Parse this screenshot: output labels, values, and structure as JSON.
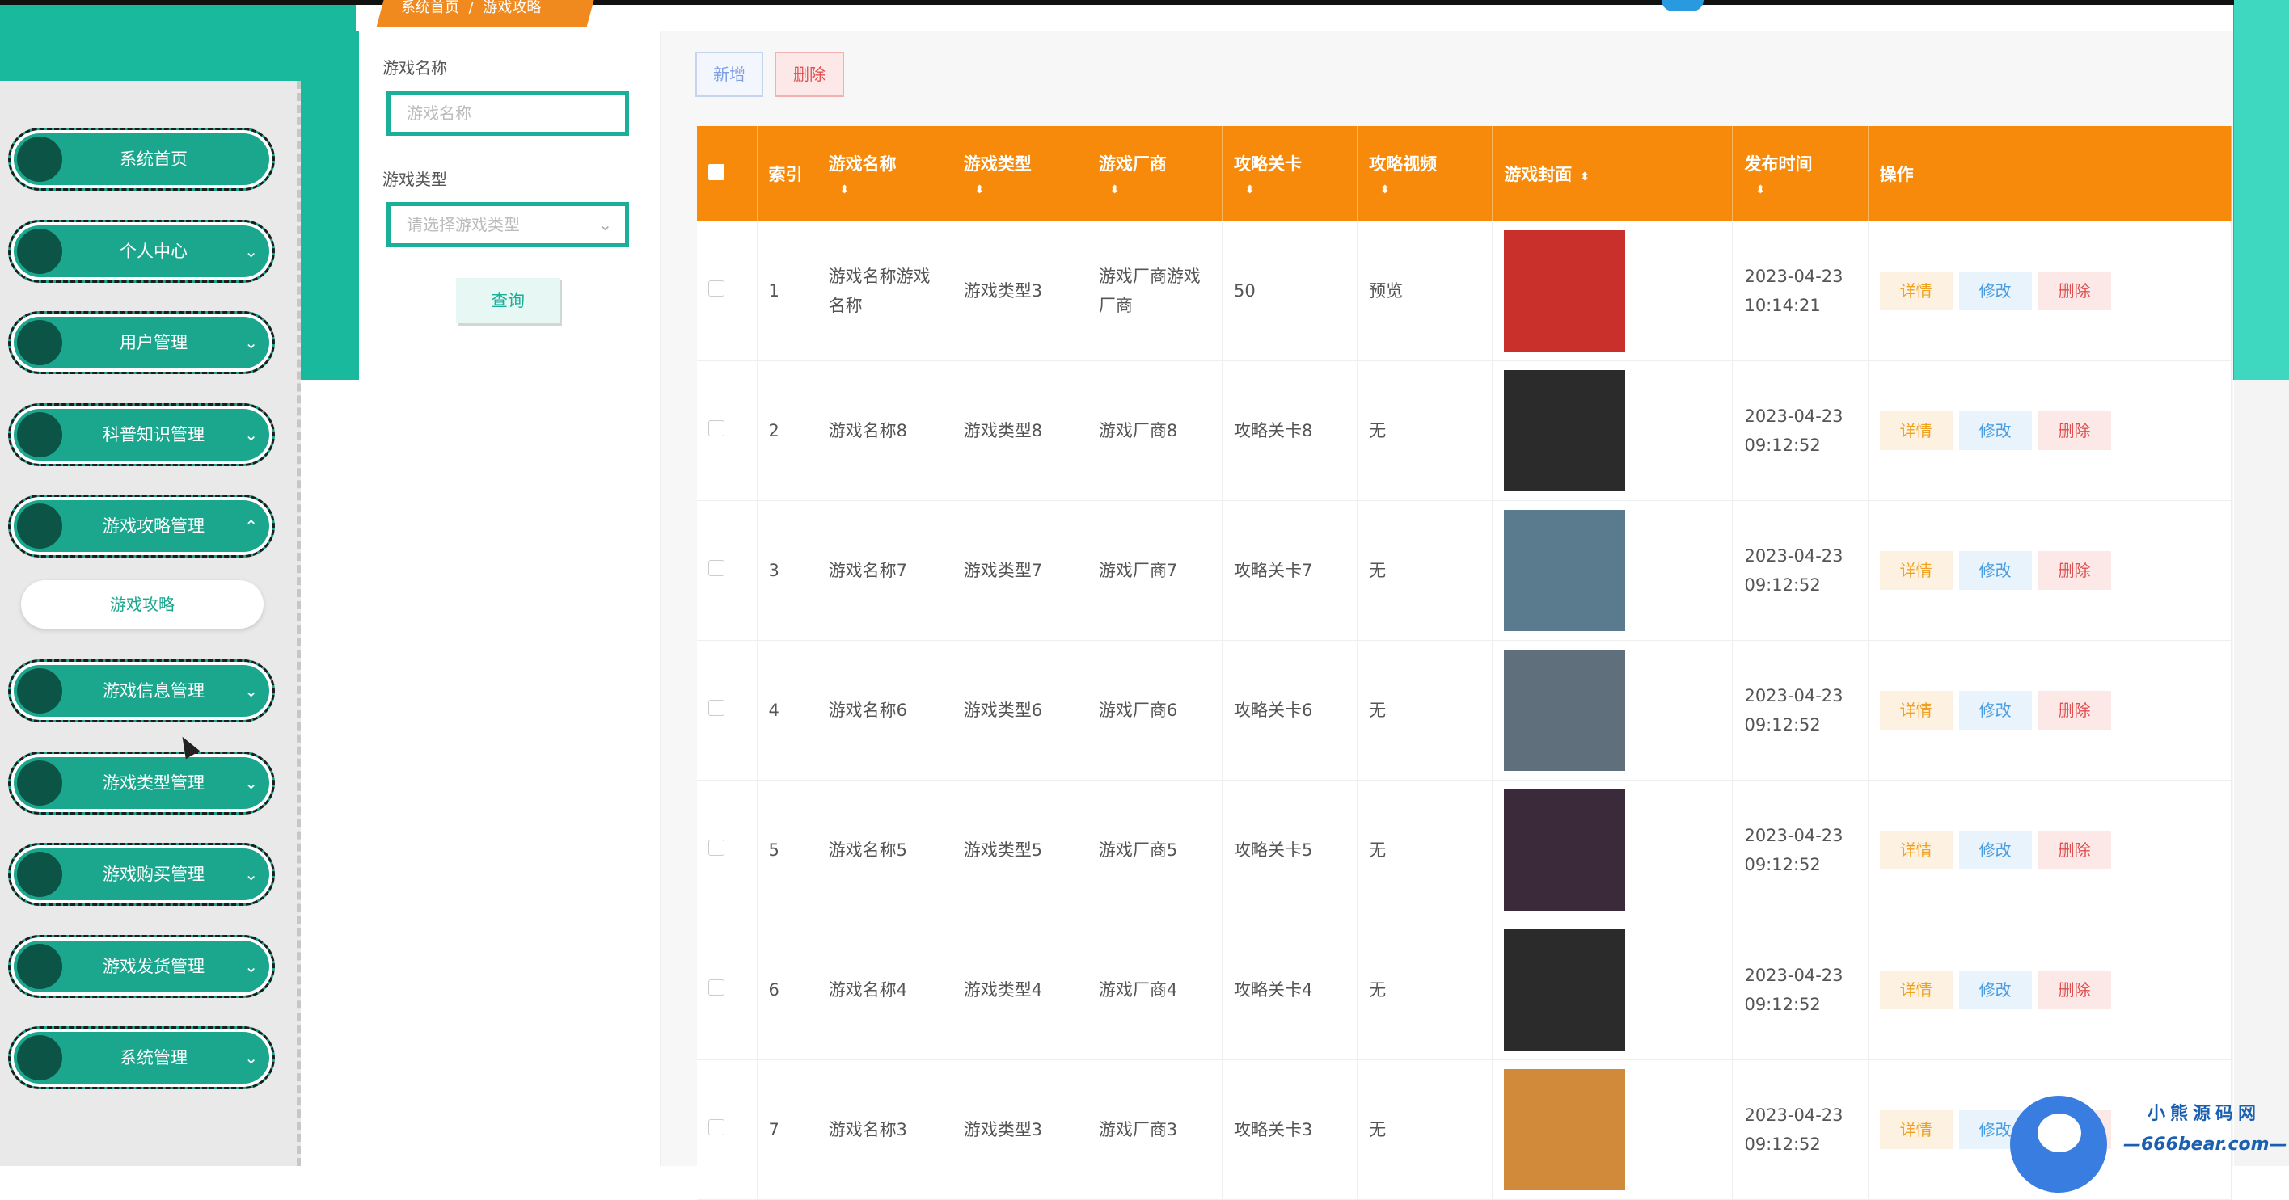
{
  "breadcrumb": {
    "home": "系统首页",
    "sep": "/",
    "current": "游戏攻略"
  },
  "sidebar": {
    "items": [
      {
        "label": "系统首页",
        "chevron": ""
      },
      {
        "label": "个人中心",
        "chevron": "⌄"
      },
      {
        "label": "用户管理",
        "chevron": "⌄"
      },
      {
        "label": "科普知识管理",
        "chevron": "⌄"
      },
      {
        "label": "游戏攻略管理",
        "chevron": "⌃"
      },
      {
        "label": "游戏信息管理",
        "chevron": "⌄"
      },
      {
        "label": "游戏类型管理",
        "chevron": "⌄"
      },
      {
        "label": "游戏购买管理",
        "chevron": "⌄"
      },
      {
        "label": "游戏发货管理",
        "chevron": "⌄"
      },
      {
        "label": "系统管理",
        "chevron": "⌄"
      }
    ],
    "sub_item": "游戏攻略"
  },
  "search": {
    "name_label": "游戏名称",
    "name_placeholder": "游戏名称",
    "type_label": "游戏类型",
    "type_placeholder": "请选择游戏类型",
    "query_button": "查询"
  },
  "toolbar": {
    "add": "新增",
    "delete": "删除"
  },
  "table": {
    "headers": {
      "index": "索引",
      "name": "游戏名称",
      "type": "游戏类型",
      "vendor": "游戏厂商",
      "level": "攻略关卡",
      "video": "攻略视频",
      "cover": "游戏封面",
      "time": "发布时间",
      "ops": "操作"
    },
    "sort_icon": "⬍",
    "ops": {
      "detail": "详情",
      "edit": "修改",
      "delete": "删除"
    },
    "rows": [
      {
        "index": "1",
        "name": "游戏名称游戏名称",
        "type": "游戏类型3",
        "vendor": "游戏厂商游戏厂商",
        "level": "50",
        "video": "预览",
        "time": "2023-04-23 10:14:21",
        "cover_color": "#c9302c"
      },
      {
        "index": "2",
        "name": "游戏名称8",
        "type": "游戏类型8",
        "vendor": "游戏厂商8",
        "level": "攻略关卡8",
        "video": "无",
        "time": "2023-04-23 09:12:52",
        "cover_color": "#2b2b2b"
      },
      {
        "index": "3",
        "name": "游戏名称7",
        "type": "游戏类型7",
        "vendor": "游戏厂商7",
        "level": "攻略关卡7",
        "video": "无",
        "time": "2023-04-23 09:12:52",
        "cover_color": "#5a7a8e"
      },
      {
        "index": "4",
        "name": "游戏名称6",
        "type": "游戏类型6",
        "vendor": "游戏厂商6",
        "level": "攻略关卡6",
        "video": "无",
        "time": "2023-04-23 09:12:52",
        "cover_color": "#5f6f7c"
      },
      {
        "index": "5",
        "name": "游戏名称5",
        "type": "游戏类型5",
        "vendor": "游戏厂商5",
        "level": "攻略关卡5",
        "video": "无",
        "time": "2023-04-23 09:12:52",
        "cover_color": "#3a2a3a"
      },
      {
        "index": "6",
        "name": "游戏名称4",
        "type": "游戏类型4",
        "vendor": "游戏厂商4",
        "level": "攻略关卡4",
        "video": "无",
        "time": "2023-04-23 09:12:52",
        "cover_color": "#2b2b2b"
      },
      {
        "index": "7",
        "name": "游戏名称3",
        "type": "游戏类型3",
        "vendor": "游戏厂商3",
        "level": "攻略关卡3",
        "video": "无",
        "time": "2023-04-23 09:12:52",
        "cover_color": "#d08a3a"
      }
    ]
  },
  "watermark": {
    "title": "小熊源码网",
    "url": "—666bear.com—"
  },
  "colors": {
    "teal": "#18b99d",
    "orange": "#f78a0a",
    "accent": "#1aaf98"
  }
}
